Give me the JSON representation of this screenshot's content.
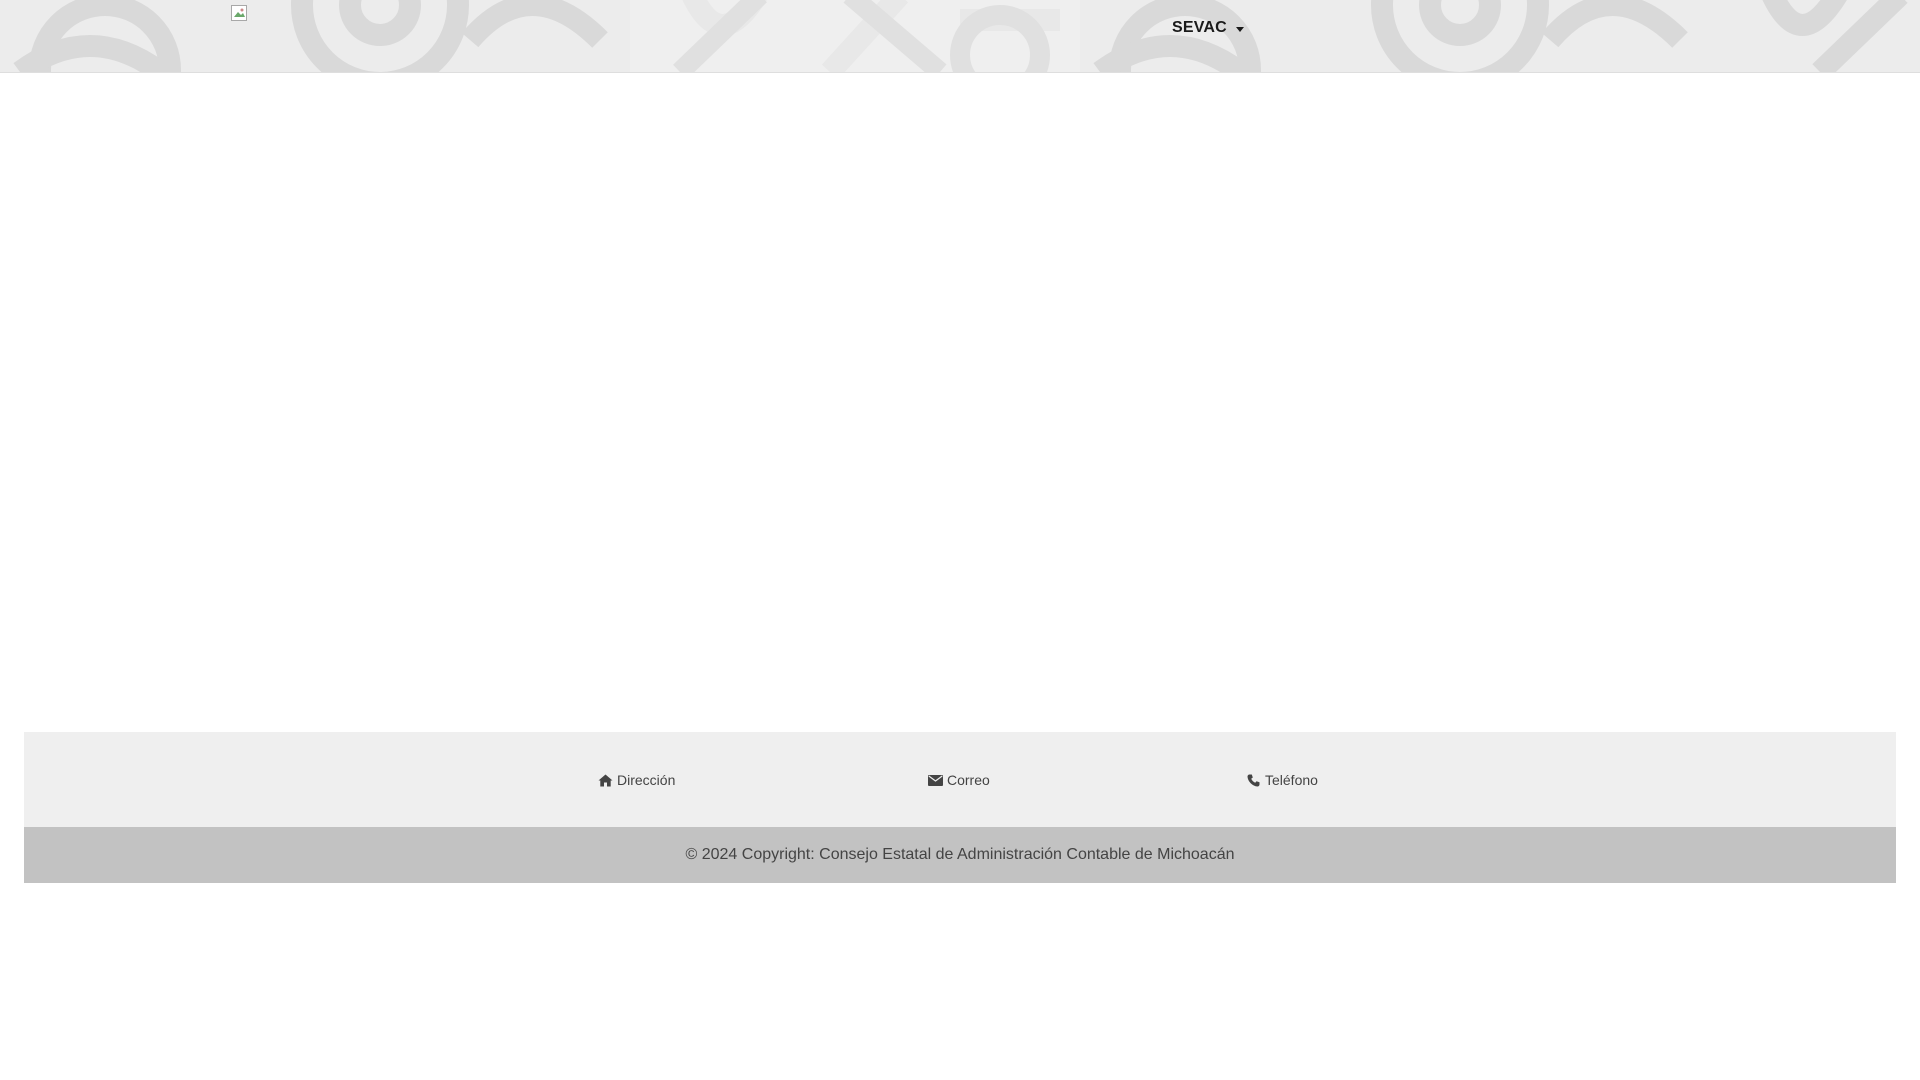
{
  "header": {
    "logo_alt": "logo",
    "nav": {
      "dropdown_label": "SEVAC"
    }
  },
  "footer": {
    "contacts": [
      {
        "label": "Dirección",
        "icon": "home-icon"
      },
      {
        "label": "Correo",
        "icon": "envelope-icon"
      },
      {
        "label": "Teléfono",
        "icon": "phone-icon"
      }
    ],
    "copyright": "© 2024 Copyright: Consejo Estatal de Administración Contable de Michoacán"
  },
  "colors": {
    "header_bg": "#ececec",
    "footer_bg": "#efefef",
    "copyright_bg": "#c2c2c2",
    "text": "#444444"
  }
}
